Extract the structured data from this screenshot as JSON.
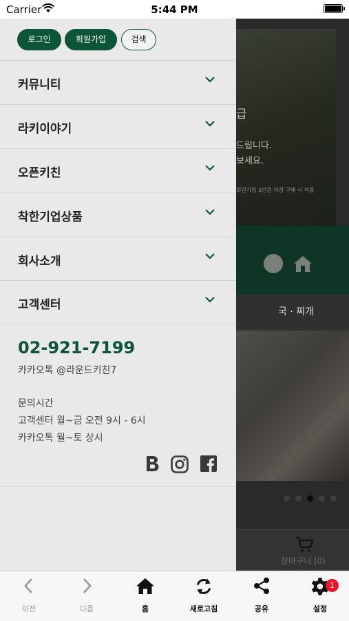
{
  "status_bar": {
    "carrier": "Carrier",
    "time": "5:44 PM"
  },
  "drawer": {
    "top_buttons": {
      "login": "로그인",
      "join": "회원가입",
      "search": "검색"
    },
    "menu": [
      {
        "label": "커뮤니티"
      },
      {
        "label": "라키이야기"
      },
      {
        "label": "오픈키친"
      },
      {
        "label": "착한기업상품"
      },
      {
        "label": "회사소개"
      },
      {
        "label": "고객센터"
      }
    ],
    "contact": {
      "phone": "02-921-7199",
      "kakao": "카카오톡 @라운드키친7",
      "hours_title": "문의시간",
      "hours_line1": "고객센터 월~금 오전 9시 - 6시",
      "hours_line2": "카카오톡 월~토 상시"
    },
    "social_icons": [
      "blog-b-icon",
      "instagram-icon",
      "facebook-icon"
    ]
  },
  "background_page": {
    "hero_heading": "급",
    "hero_line1": "드립니다.",
    "hero_line2": "보세요.",
    "hero_small": "회원가입 3만원 이상 구매 시 적용",
    "tab_label": "국 · 찌개",
    "cart_label": "장바구니 (0)",
    "carousel_active_index": 2,
    "carousel_count": 5
  },
  "tabbar": {
    "items": [
      {
        "label": "이전",
        "icon": "chevron-left-icon",
        "enabled": false
      },
      {
        "label": "다음",
        "icon": "chevron-right-icon",
        "enabled": false
      },
      {
        "label": "홈",
        "icon": "home-icon",
        "enabled": true
      },
      {
        "label": "새로고침",
        "icon": "refresh-icon",
        "enabled": true
      },
      {
        "label": "공유",
        "icon": "share-icon",
        "enabled": true
      },
      {
        "label": "설정",
        "icon": "gear-icon",
        "enabled": true
      }
    ],
    "settings_badge": "1"
  },
  "colors": {
    "brand_green": "#0d5538",
    "badge_red": "#e8152b",
    "drawer_bg": "#e9e9e9"
  }
}
